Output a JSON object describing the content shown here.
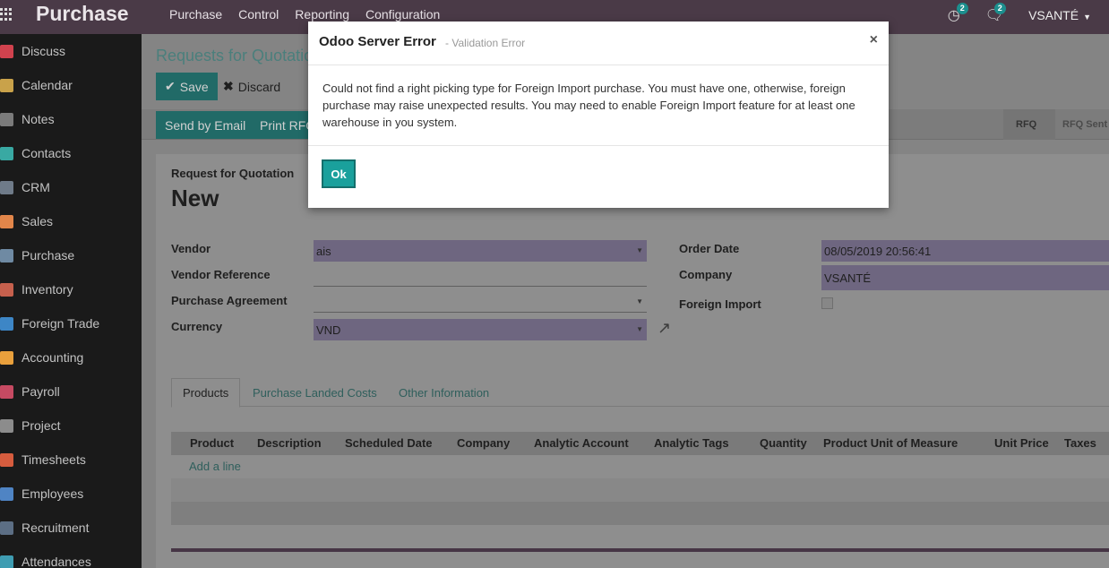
{
  "topbar": {
    "brand": "Purchase",
    "menu": [
      "Purchase",
      "Control",
      "Reporting",
      "Configuration"
    ],
    "activities_count": "2",
    "messages_count": "2",
    "user": "VSANTÉ"
  },
  "sidebar": {
    "items": [
      {
        "label": "Discuss",
        "color": "#d1424e"
      },
      {
        "label": "Calendar",
        "color": "#c9a24a"
      },
      {
        "label": "Notes",
        "color": "#7b7b7b"
      },
      {
        "label": "Contacts",
        "color": "#39a9a3"
      },
      {
        "label": "CRM",
        "color": "#6f7b89"
      },
      {
        "label": "Sales",
        "color": "#e2864a"
      },
      {
        "label": "Purchase",
        "color": "#6f8aa3"
      },
      {
        "label": "Inventory",
        "color": "#c6604d"
      },
      {
        "label": "Foreign Trade",
        "color": "#3d86c6"
      },
      {
        "label": "Accounting",
        "color": "#e9a03c"
      },
      {
        "label": "Payroll",
        "color": "#c64a62"
      },
      {
        "label": "Project",
        "color": "#8c8c8c"
      },
      {
        "label": "Timesheets",
        "color": "#d65c3e"
      },
      {
        "label": "Employees",
        "color": "#4f84c4"
      },
      {
        "label": "Recruitment",
        "color": "#5c6e84"
      },
      {
        "label": "Attendances",
        "color": "#3f9db2"
      }
    ]
  },
  "form": {
    "breadcrumb": "Requests for Quotatio",
    "save": "Save",
    "discard": "Discard",
    "send_email": "Send by Email",
    "print_rfq": "Print RFQ",
    "stages": [
      "RFQ",
      "RFQ Sent"
    ],
    "subtitle": "Request for Quotation",
    "title": "New",
    "vendor_label": "Vendor",
    "vendor_value": "ais",
    "vendor_ref_label": "Vendor Reference",
    "agreement_label": "Purchase Agreement",
    "currency_label": "Currency",
    "currency_value": "VND",
    "order_date_label": "Order Date",
    "order_date_value": "08/05/2019 20:56:41",
    "company_label": "Company",
    "company_value": "VSANTÉ",
    "foreign_import_label": "Foreign Import",
    "tabs": [
      "Products",
      "Purchase Landed Costs",
      "Other Information"
    ],
    "columns": [
      "Product",
      "Description",
      "Scheduled Date",
      "Company",
      "Analytic Account",
      "Analytic Tags",
      "Quantity",
      "Product Unit of Measure",
      "Unit Price",
      "Taxes"
    ],
    "add_line": "Add a line"
  },
  "dialog": {
    "title": "Odoo Server Error",
    "subtitle": "- Validation Error",
    "message": "Could not find a right picking type for Foreign Import purchase. You must have one, otherwise, foreign purchase may raise unexpected results. You may need to enable Foreign Import feature for at least one warehouse in you system.",
    "ok": "Ok"
  },
  "colors": {
    "accent": "#1aa09c",
    "topbar": "#4a3a47"
  }
}
